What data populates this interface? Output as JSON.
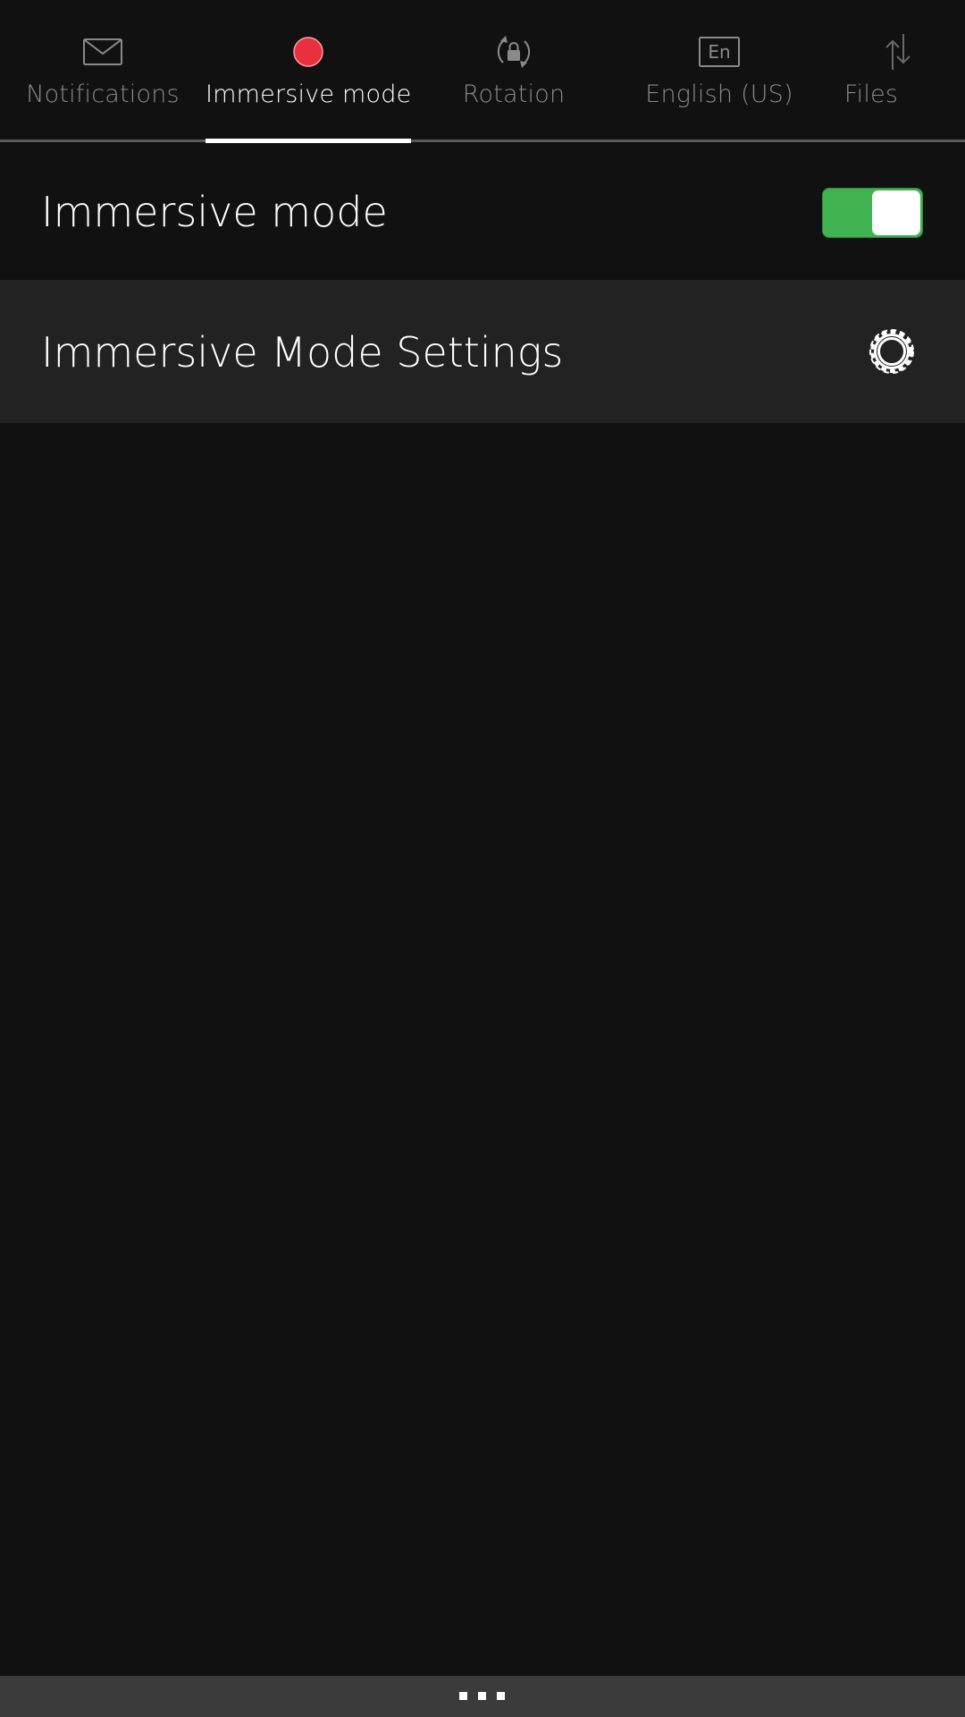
{
  "tabs": [
    {
      "label": "Notifications",
      "icon": "envelope-icon",
      "active": false
    },
    {
      "label": "Immersive mode",
      "icon": "record-dot-icon",
      "active": true
    },
    {
      "label": "Rotation",
      "icon": "rotation-lock-icon",
      "active": false
    },
    {
      "label": "English (US)",
      "icon": "keyboard-language-icon",
      "icon_text": "En",
      "active": false
    },
    {
      "label": "Files",
      "icon": "transfer-arrows-icon",
      "active": false
    }
  ],
  "rows": {
    "toggle": {
      "title": "Immersive mode",
      "checked": true
    },
    "settings": {
      "title": "Immersive Mode Settings",
      "icon": "gear-icon"
    }
  },
  "colors": {
    "background": "#111111",
    "toggle_on": "#3eb34f",
    "record_dot": "#e8303f",
    "settings_row": "#222222",
    "handle_bar": "#3b3b3b"
  }
}
